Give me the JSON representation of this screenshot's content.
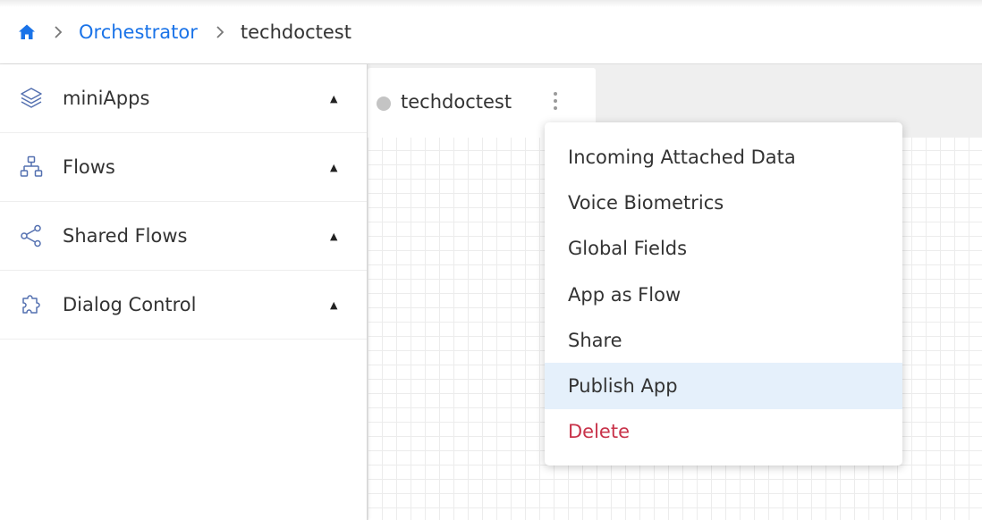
{
  "breadcrumb": {
    "home_icon": "home-icon",
    "items": [
      "Orchestrator",
      "techdoctest"
    ]
  },
  "sidebar": {
    "items": [
      {
        "label": "miniApps",
        "icon": "layers-icon"
      },
      {
        "label": "Flows",
        "icon": "flow-tree-icon"
      },
      {
        "label": "Shared Flows",
        "icon": "share-icon"
      },
      {
        "label": "Dialog Control",
        "icon": "puzzle-icon"
      }
    ],
    "caret": "▲"
  },
  "tab": {
    "label": "techdoctest"
  },
  "context_menu": {
    "items": [
      "Incoming Attached Data",
      "Voice Biometrics",
      "Global Fields",
      "App as Flow",
      "Share",
      "Publish App",
      "Delete"
    ],
    "highlighted": "Publish App",
    "danger": "Delete"
  },
  "colors": {
    "link": "#1a73e8",
    "icon": "#5470b0",
    "danger": "#c8334a",
    "highlight": "#e5f0fb"
  }
}
